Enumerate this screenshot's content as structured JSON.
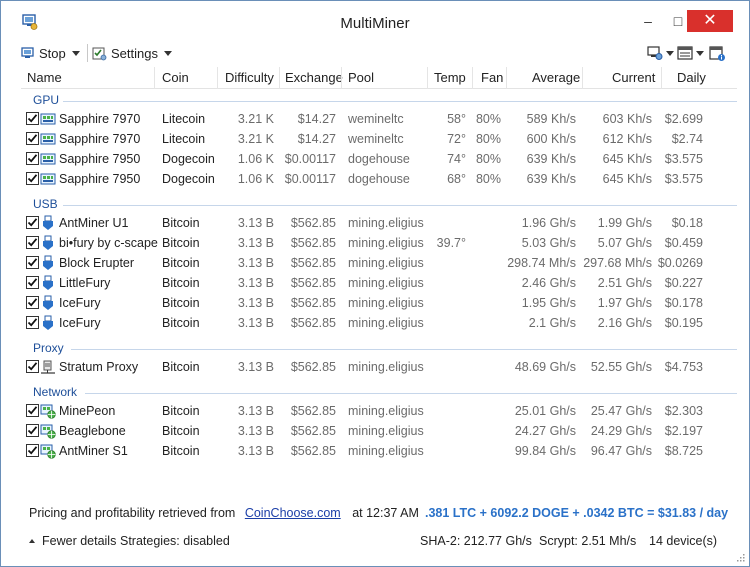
{
  "window": {
    "title": "MultiMiner"
  },
  "toolbar": {
    "stop_label": "Stop",
    "settings_label": "Settings"
  },
  "columns": [
    "Name",
    "Coin",
    "Difficulty",
    "Exchange",
    "Pool",
    "Temp",
    "Fan",
    "Average",
    "Current",
    "Daily"
  ],
  "groups": [
    {
      "label": "GPU"
    },
    {
      "label": "USB"
    },
    {
      "label": "Proxy"
    },
    {
      "label": "Network"
    }
  ],
  "rows": [
    {
      "name": "Sapphire 7970",
      "coin": "Litecoin",
      "difficulty": "3.21 K",
      "exchange": "$14.27",
      "pool": "wemineltc",
      "temp": "58°",
      "fan": "80%",
      "average": "589 Kh/s",
      "current": "603 Kh/s",
      "daily": "$2.699",
      "icon": "gpu-icon"
    },
    {
      "name": "Sapphire 7970",
      "coin": "Litecoin",
      "difficulty": "3.21 K",
      "exchange": "$14.27",
      "pool": "wemineltc",
      "temp": "72°",
      "fan": "80%",
      "average": "600 Kh/s",
      "current": "612 Kh/s",
      "daily": "$2.74",
      "icon": "gpu-icon"
    },
    {
      "name": "Sapphire 7950",
      "coin": "Dogecoin",
      "difficulty": "1.06 K",
      "exchange": "$0.00117",
      "pool": "dogehouse",
      "temp": "74°",
      "fan": "80%",
      "average": "639 Kh/s",
      "current": "645 Kh/s",
      "daily": "$3.575",
      "icon": "gpu-icon"
    },
    {
      "name": "Sapphire 7950",
      "coin": "Dogecoin",
      "difficulty": "1.06 K",
      "exchange": "$0.00117",
      "pool": "dogehouse",
      "temp": "68°",
      "fan": "80%",
      "average": "639 Kh/s",
      "current": "645 Kh/s",
      "daily": "$3.575",
      "icon": "gpu-icon"
    },
    {
      "name": "AntMiner U1",
      "coin": "Bitcoin",
      "difficulty": "3.13 B",
      "exchange": "$562.85",
      "pool": "mining.eligius",
      "temp": "",
      "fan": "",
      "average": "1.96 Gh/s",
      "current": "1.99 Gh/s",
      "daily": "$0.18",
      "icon": "usb-icon"
    },
    {
      "name": "bi•fury by c-scape",
      "coin": "Bitcoin",
      "difficulty": "3.13 B",
      "exchange": "$562.85",
      "pool": "mining.eligius",
      "temp": "39.7°",
      "fan": "",
      "average": "5.03 Gh/s",
      "current": "5.07 Gh/s",
      "daily": "$0.459",
      "icon": "usb-icon"
    },
    {
      "name": "Block Erupter",
      "coin": "Bitcoin",
      "difficulty": "3.13 B",
      "exchange": "$562.85",
      "pool": "mining.eligius",
      "temp": "",
      "fan": "",
      "average": "298.74 Mh/s",
      "current": "297.68 Mh/s",
      "daily": "$0.0269",
      "icon": "usb-icon"
    },
    {
      "name": "LittleFury",
      "coin": "Bitcoin",
      "difficulty": "3.13 B",
      "exchange": "$562.85",
      "pool": "mining.eligius",
      "temp": "",
      "fan": "",
      "average": "2.46 Gh/s",
      "current": "2.51 Gh/s",
      "daily": "$0.227",
      "icon": "usb-icon"
    },
    {
      "name": "IceFury",
      "coin": "Bitcoin",
      "difficulty": "3.13 B",
      "exchange": "$562.85",
      "pool": "mining.eligius",
      "temp": "",
      "fan": "",
      "average": "1.95 Gh/s",
      "current": "1.97 Gh/s",
      "daily": "$0.178",
      "icon": "usb-icon"
    },
    {
      "name": "IceFury",
      "coin": "Bitcoin",
      "difficulty": "3.13 B",
      "exchange": "$562.85",
      "pool": "mining.eligius",
      "temp": "",
      "fan": "",
      "average": "2.1 Gh/s",
      "current": "2.16 Gh/s",
      "daily": "$0.195",
      "icon": "usb-icon"
    },
    {
      "name": "Stratum Proxy",
      "coin": "Bitcoin",
      "difficulty": "3.13 B",
      "exchange": "$562.85",
      "pool": "mining.eligius",
      "temp": "",
      "fan": "",
      "average": "48.69 Gh/s",
      "current": "52.55 Gh/s",
      "daily": "$4.753",
      "icon": "proxy-icon"
    },
    {
      "name": "MinePeon",
      "coin": "Bitcoin",
      "difficulty": "3.13 B",
      "exchange": "$562.85",
      "pool": "mining.eligius",
      "temp": "",
      "fan": "",
      "average": "25.01 Gh/s",
      "current": "25.47 Gh/s",
      "daily": "$2.303",
      "icon": "network-icon"
    },
    {
      "name": "Beaglebone",
      "coin": "Bitcoin",
      "difficulty": "3.13 B",
      "exchange": "$562.85",
      "pool": "mining.eligius",
      "temp": "",
      "fan": "",
      "average": "24.27 Gh/s",
      "current": "24.29 Gh/s",
      "daily": "$2.197",
      "icon": "network-icon"
    },
    {
      "name": "AntMiner S1",
      "coin": "Bitcoin",
      "difficulty": "3.13 B",
      "exchange": "$562.85",
      "pool": "mining.eligius",
      "temp": "",
      "fan": "",
      "average": "99.84 Gh/s",
      "current": "96.47 Gh/s",
      "daily": "$8.725",
      "icon": "network-icon"
    }
  ],
  "footer": {
    "pricing_text": "Pricing and profitability retrieved from",
    "pricing_link": "CoinChoose.com",
    "pricing_time": "at 12:37 AM",
    "totals": ".381 LTC + 6092.2 DOGE + .0342 BTC = $31.83 / day",
    "fewer_details": "Fewer details",
    "strategies": "Strategies: disabled",
    "sha2": "SHA-2: 212.77 Gh/s",
    "scrypt": "Scrypt: 2.51 Mh/s",
    "devices": "14 device(s)"
  },
  "colors": {
    "accent": "#2a71c8",
    "group": "#1e4f99",
    "close": "#d9302c"
  }
}
